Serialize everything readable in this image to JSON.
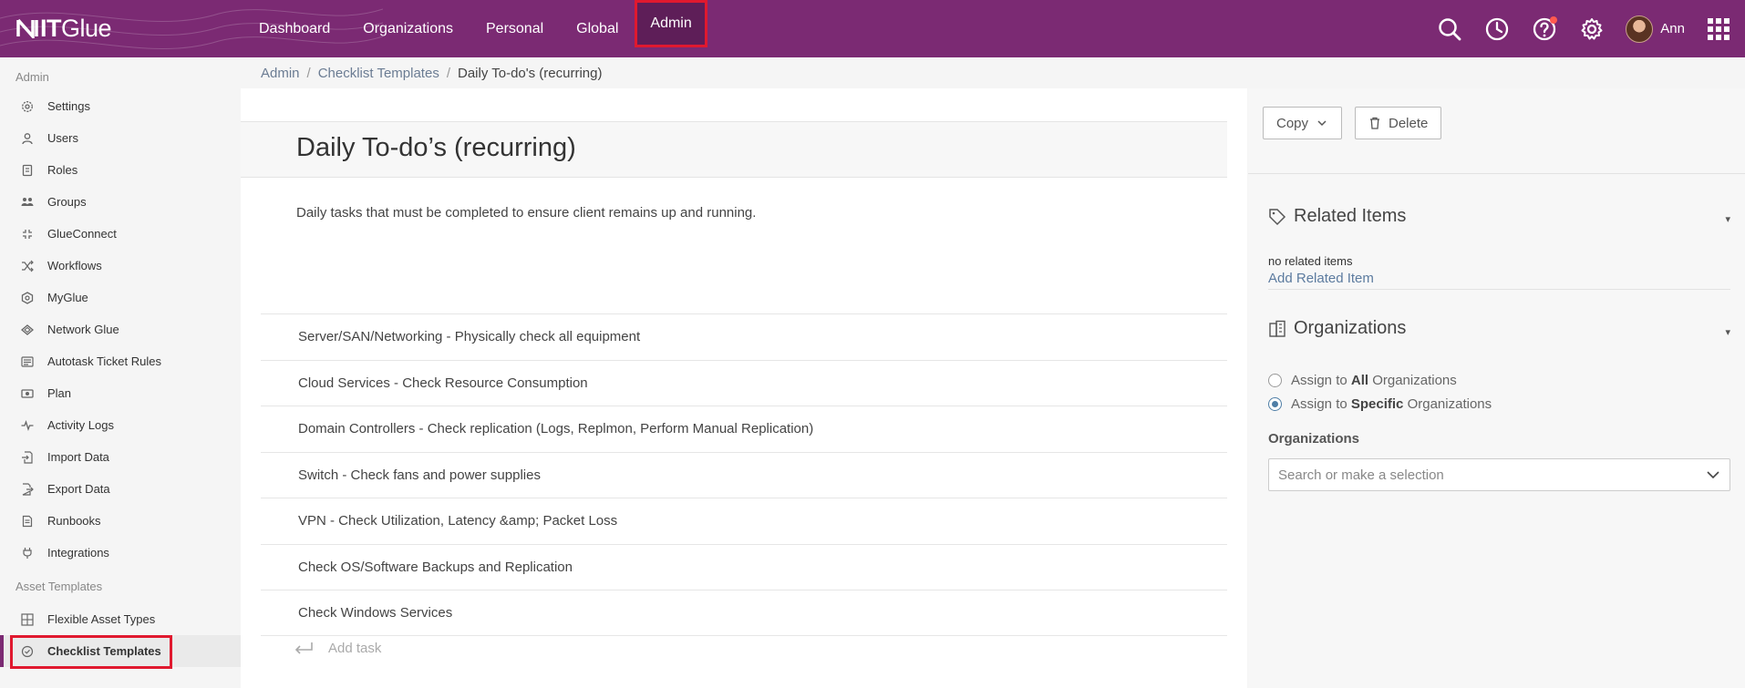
{
  "app": {
    "logo_it": "IT",
    "logo_glue": "Glue"
  },
  "nav": {
    "items": [
      "Dashboard",
      "Organizations",
      "Personal",
      "Global",
      "Admin"
    ],
    "active": "Admin",
    "user_name": "Ann"
  },
  "sidebar": {
    "admin_heading": "Admin",
    "admin_items": [
      {
        "label": "Settings",
        "icon": "gear-icon"
      },
      {
        "label": "Users",
        "icon": "user-icon"
      },
      {
        "label": "Roles",
        "icon": "id-badge-icon"
      },
      {
        "label": "Groups",
        "icon": "users-icon"
      },
      {
        "label": "GlueConnect",
        "icon": "connect-icon"
      },
      {
        "label": "Workflows",
        "icon": "shuffle-icon"
      },
      {
        "label": "MyGlue",
        "icon": "hexagon-gear-icon"
      },
      {
        "label": "Network Glue",
        "icon": "network-icon"
      },
      {
        "label": "Autotask Ticket Rules",
        "icon": "rules-icon"
      },
      {
        "label": "Plan",
        "icon": "money-icon"
      },
      {
        "label": "Activity Logs",
        "icon": "pulse-icon"
      },
      {
        "label": "Import Data",
        "icon": "import-icon"
      },
      {
        "label": "Export Data",
        "icon": "export-icon"
      },
      {
        "label": "Runbooks",
        "icon": "book-icon"
      },
      {
        "label": "Integrations",
        "icon": "plug-icon"
      }
    ],
    "asset_heading": "Asset Templates",
    "asset_items": [
      {
        "label": "Flexible Asset Types",
        "icon": "grid-icon"
      },
      {
        "label": "Checklist Templates",
        "icon": "check-circle-icon",
        "active": true
      }
    ]
  },
  "breadcrumb": {
    "admin": "Admin",
    "sep": "/",
    "templates": "Checklist Templates",
    "current": "Daily To-do's (recurring)"
  },
  "main": {
    "title": "Daily To-do’s (recurring)",
    "description": "Daily tasks that must be completed to ensure client remains up and running.",
    "tasks": [
      "Server/SAN/Networking - Physically check all equipment",
      "Cloud Services - Check Resource Consumption",
      "Domain Controllers - Check replication (Logs, Replmon, Perform Manual Replication)",
      "Switch - Check fans and power supplies",
      "VPN - Check Utilization, Latency &amp; Packet Loss",
      "Check OS/Software Backups and Replication",
      "Check Windows Services"
    ],
    "add_task": "Add task"
  },
  "right": {
    "copy_label": "Copy",
    "delete_label": "Delete",
    "related_heading": "Related Items",
    "no_related": "no related items",
    "add_related": "Add Related Item",
    "orgs_heading": "Organizations",
    "assign_all_pre": "Assign to ",
    "assign_all_bold": "All",
    "assign_all_post": " Organizations",
    "assign_specific_pre": "Assign to ",
    "assign_specific_bold": "Specific",
    "assign_specific_post": " Organizations",
    "selected_assignment": "specific",
    "orgs_label": "Organizations",
    "orgs_placeholder": "Search or make a selection"
  },
  "colors": {
    "brand": "#7b2a73",
    "highlight": "#e0192f",
    "link": "#5c7b9f"
  }
}
